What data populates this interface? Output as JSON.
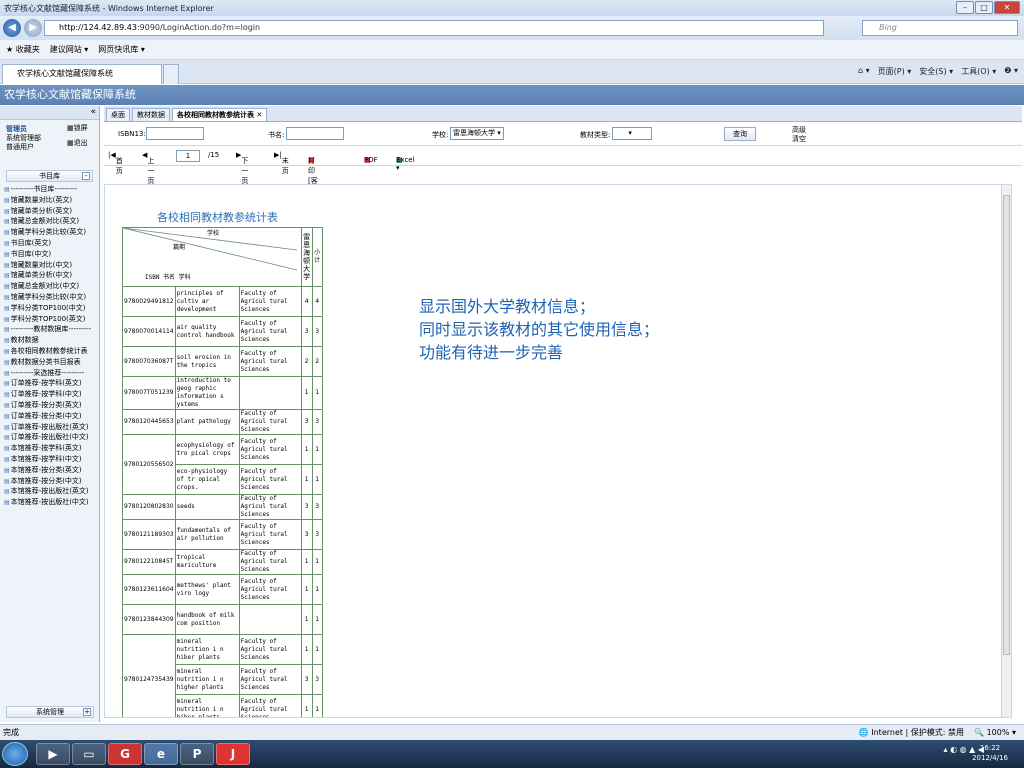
{
  "browser": {
    "window_title": "农学核心文献馆藏保障系统 - Windows Internet Explorer",
    "url_host": "http://124.42.89.43",
    "url_path": ":9090/LoginAction.do?m=login",
    "search_placeholder": "Bing",
    "favorites_label": "收藏夹",
    "fav_items": [
      "建议网站 ▾",
      "网页快讯库 ▾"
    ],
    "tab_label": "农学核心文献馆藏保障系统",
    "cmd_items": [
      "页面(P) ▾",
      "安全(S) ▾",
      "工具(O) ▾",
      "❷ ▾"
    ]
  },
  "app": {
    "header": "农学核心文献馆藏保障系统"
  },
  "sidebar": {
    "user_role": "管理员",
    "user_lines": [
      "系统管理部",
      "普通用户"
    ],
    "lock_label": "锁屏",
    "logout_label": "退出",
    "tree_title": "书目库",
    "items": [
      "---------书目库---------",
      "馆藏数量对比(英文)",
      "馆藏单类分析(英文)",
      "馆藏总金额对比(英文)",
      "馆藏学科分类比较(英文)",
      "书目库(英文)",
      "书目库(中文)",
      "馆藏数量对比(中文)",
      "馆藏单类分析(中文)",
      "馆藏总金额对比(中文)",
      "馆藏学科分类比较(中文)",
      "学科分类TOP100(中文)",
      "学科分类TOP100(英文)",
      "---------教材数据库---------",
      "教材数据",
      "各校相同教材教参统计表",
      "教材数据分类书目报表",
      "---------采选推荐---------",
      "订单推荐-按学科(英文)",
      "订单推荐-按学科(中文)",
      "订单推荐-按分类(英文)",
      "订单推荐-按分类(中文)",
      "订单推荐-按出版社(英文)",
      "订单推荐-按出版社(中文)",
      "本馆推荐-按学科(英文)",
      "本馆推荐-按学科(中文)",
      "本馆推荐-按分类(英文)",
      "本馆推荐-按分类(中文)",
      "本馆推荐-按出版社(英文)",
      "本馆推荐-按出版社(中文)"
    ],
    "bottom_label": "系统管理"
  },
  "main": {
    "tabs": [
      "桌面",
      "教材数据",
      "各校相同教材教参统计表"
    ],
    "form": {
      "isbn_label": "ISBN13:",
      "title_label": "书名:",
      "school_label": "学校:",
      "school_value": "雷恩海顿大学",
      "type_label": "教材类型:",
      "query_label": "查询",
      "adv_label": "高级",
      "clear_label": "清空"
    },
    "toolbar": {
      "first": "首页",
      "prev": "上一页",
      "page": "1",
      "total": "/15",
      "next": "下一页",
      "last": "末页",
      "print": "打印[客户端]",
      "pdf": "PDF",
      "excel": "Excel ▾"
    },
    "report": {
      "title": "各校相同教材教参统计表",
      "hdr_school": "学校",
      "hdr_schoolval": "篇期",
      "hdr_isbn": "ISBN  书名  学科",
      "col_school": "雷恩海顿大学",
      "col_subtotal": "小计",
      "rows": [
        {
          "isbn": "9780029491812",
          "title": "principles of cultiv ar development",
          "fac": "Faculty of Agricul tural Sciences",
          "n": "4",
          "s": "4"
        },
        {
          "isbn": "9780070014114",
          "title": "air quality control handbook",
          "fac": "Faculty of Agricul tural Sciences",
          "n": "3",
          "s": "3"
        },
        {
          "isbn": "978007036087T",
          "title": "soil erosion in the tropics",
          "fac": "Faculty of Agricul tural Sciences",
          "n": "2",
          "s": "2"
        },
        {
          "isbn": "978007T051239",
          "title": "introduction to geog raphic information s ystems",
          "fac": "",
          "n": "1",
          "s": "1"
        },
        {
          "isbn": "9780120445653",
          "title": "plant pathology",
          "fac": "Faculty of Agricul tural Sciences",
          "n": "3",
          "s": "3"
        },
        {
          "isbn": "9780120556502",
          "title": "ecophysiology of tro pical crops",
          "fac": "Faculty of Agricul tural Sciences",
          "n": "1",
          "s": "1"
        },
        {
          "isbn": "",
          "title": "eco-physiology of tr opical crops.",
          "fac": "Faculty of Agricul tural Sciences",
          "n": "1",
          "s": "1"
        },
        {
          "isbn": "9780120802830",
          "title": "seeds",
          "fac": "Faculty of Agricul tural Sciences",
          "n": "3",
          "s": "3"
        },
        {
          "isbn": "9780121189303",
          "title": "fundamentals of air pollution",
          "fac": "Faculty of Agricul tural Sciences",
          "n": "3",
          "s": "3"
        },
        {
          "isbn": "978012210845T",
          "title": "tropical mariculture",
          "fac": "Faculty of Agricul tural Sciences",
          "n": "1",
          "s": "1"
        },
        {
          "isbn": "9780123611604",
          "title": "metthews' plant viro logy",
          "fac": "Faculty of Agricul tural Sciences",
          "n": "1",
          "s": "1"
        },
        {
          "isbn": "9780123844309",
          "title": "handbook of milk com position",
          "fac": "",
          "n": "1",
          "s": "1"
        },
        {
          "isbn": "",
          "title": "mineral nutrition i n hiber plants",
          "fac": "Faculty of Agricul tural Sciences",
          "n": "1",
          "s": "1"
        },
        {
          "isbn": "9780124735439",
          "title": "mineral nutrition i n higher plants",
          "fac": "Faculty of Agricul tural Sciences",
          "n": "3",
          "s": "3"
        },
        {
          "isbn": "",
          "title": "mineral nutrition i n hiber plants.",
          "fac": "Faculty of Agricul tural Sciences",
          "n": "1",
          "s": "1"
        }
      ]
    },
    "note_lines": [
      "显示国外大学教材信息；",
      "同时显示该教材的其它使用信息；",
      "功能有待进一步完善"
    ]
  },
  "status": {
    "left": "完成",
    "zone": "Internet | 保护模式: 禁用",
    "zoom": "100%"
  },
  "clock": {
    "time": "16:22",
    "date": "2012/4/16"
  }
}
